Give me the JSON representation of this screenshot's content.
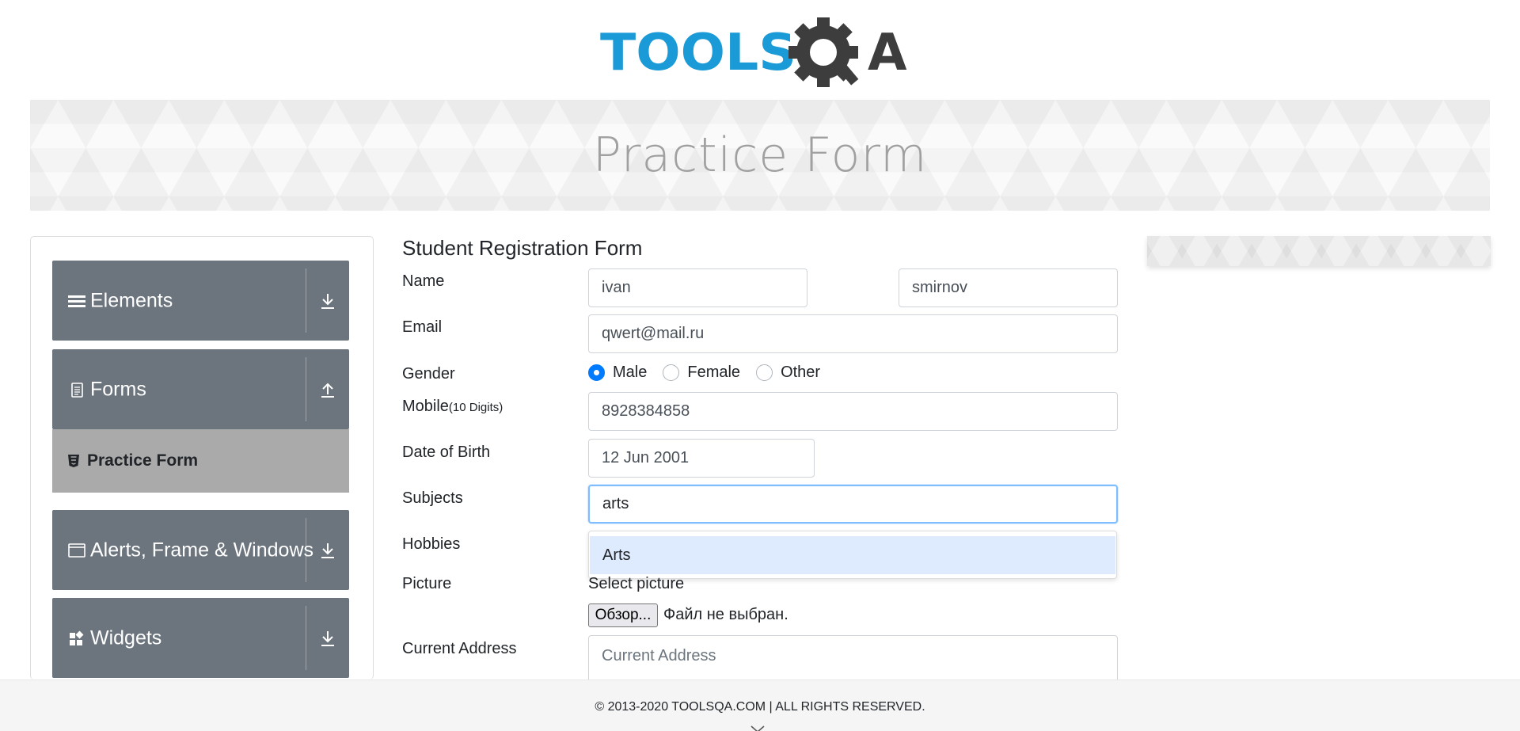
{
  "logo": {
    "text_left": "TOOLS",
    "text_right": "A",
    "color_blue": "#1a9ad6",
    "color_dark": "#3d3d3d"
  },
  "banner": {
    "title": "Practice Form"
  },
  "sidebar": {
    "groups": [
      {
        "label": "Elements",
        "icon": "hamburger-icon",
        "toggle": "download-arrow-icon"
      },
      {
        "label": "Forms",
        "icon": "document-icon",
        "toggle": "upload-arrow-icon"
      },
      {
        "label": "Alerts, Frame & Windows",
        "icon": "window-icon",
        "toggle": "download-arrow-icon"
      },
      {
        "label": "Widgets",
        "icon": "widgets-icon",
        "toggle": "download-arrow-icon"
      }
    ],
    "active_item": {
      "label": "Practice Form",
      "icon": "html5-icon"
    }
  },
  "form": {
    "title": "Student Registration Form",
    "labels": {
      "name": "Name",
      "email": "Email",
      "gender": "Gender",
      "mobile": "Mobile",
      "mobile_hint": "(10 Digits)",
      "dob": "Date of Birth",
      "subjects": "Subjects",
      "hobbies": "Hobbies",
      "picture": "Picture",
      "address": "Current Address"
    },
    "first_name": "ivan",
    "last_name": "smirnov",
    "email": "qwert@mail.ru",
    "gender_options": [
      "Male",
      "Female",
      "Other"
    ],
    "gender_selected": "Male",
    "mobile": "8928384858",
    "dob": "12 Jun 2001",
    "subjects_value": "arts",
    "subjects_suggestion": "Arts",
    "picture_label": "Select picture",
    "file_button": "Обзор...",
    "file_status": "Файл не выбран.",
    "address_placeholder": "Current Address"
  },
  "footer": {
    "text": "© 2013-2020 TOOLSQA.COM | ALL RIGHTS RESERVED."
  },
  "colors": {
    "sidebar_group": "#6c757d",
    "active_item": "#aaaaaa",
    "accent": "#007bff",
    "focus_border": "#80bdff",
    "suggestion_bg": "#deebff"
  }
}
